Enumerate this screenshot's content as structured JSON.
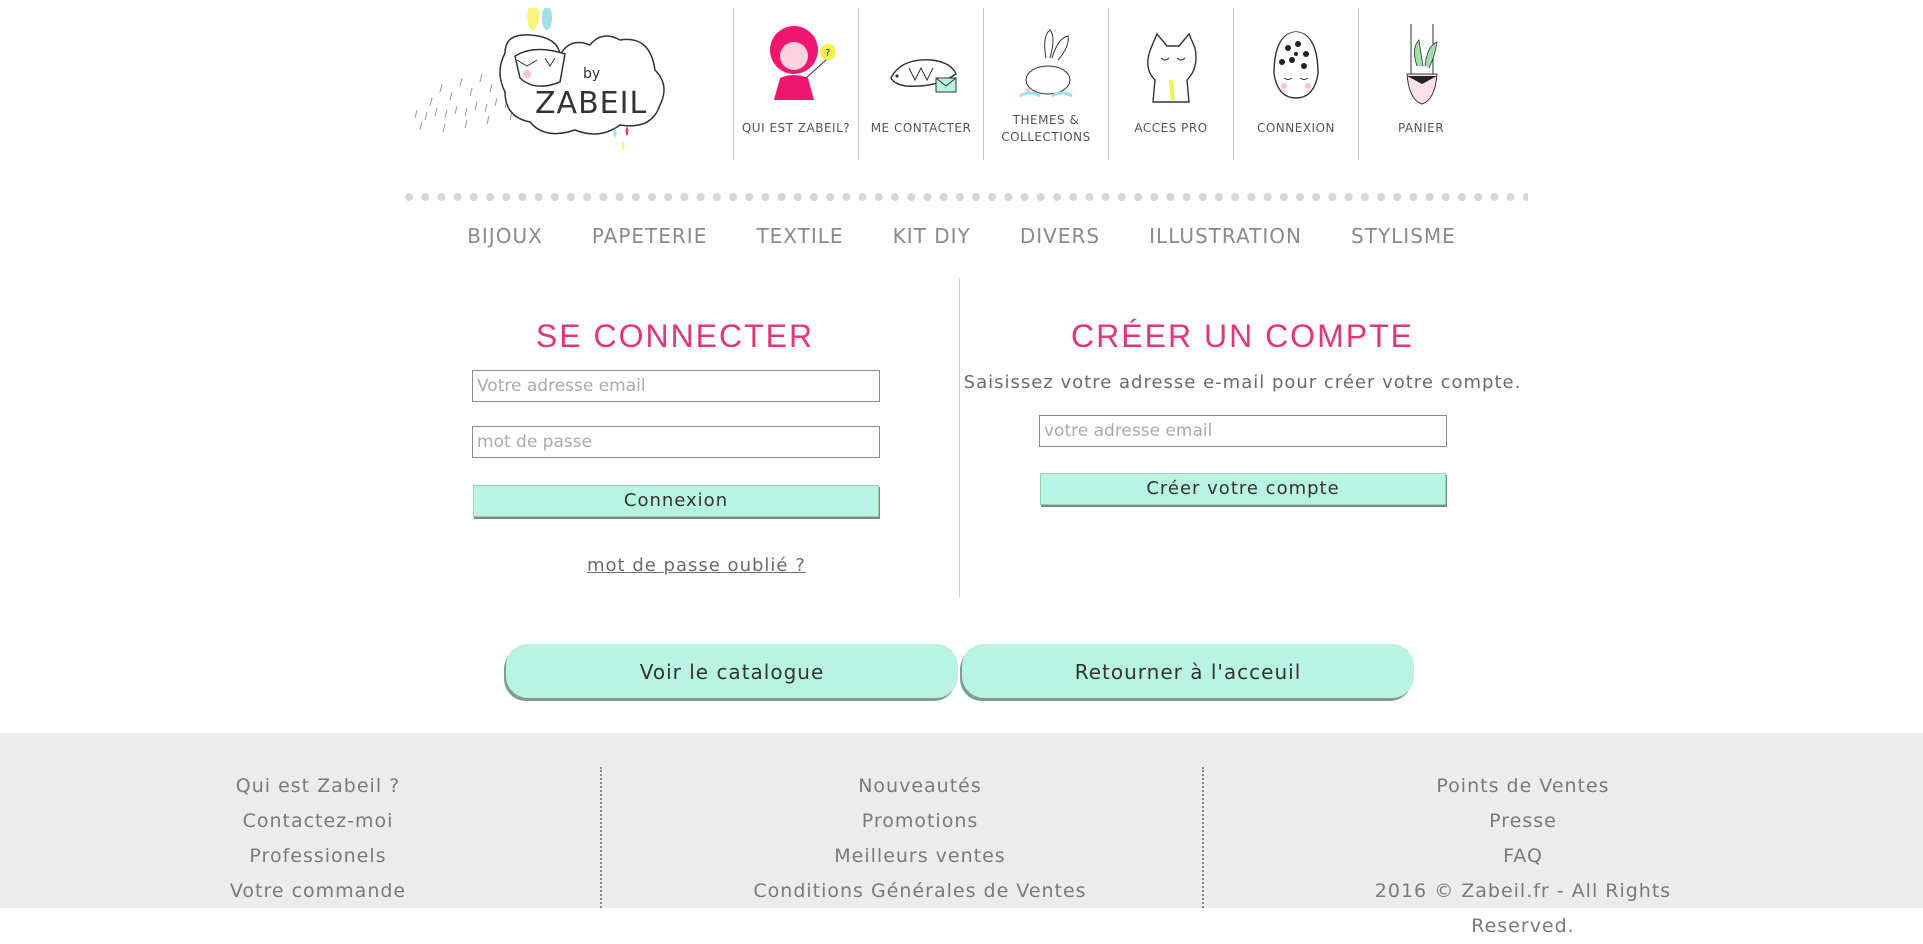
{
  "logo": {
    "by": "by",
    "brand": "ZABEIL"
  },
  "topnav": [
    {
      "label": "QUI EST ZABEIL?",
      "icon": "red-hood-girl-icon"
    },
    {
      "label": "ME CONTACTER",
      "icon": "bird-letter-icon"
    },
    {
      "label": "THEMES &",
      "label2": "COLLECTIONS",
      "icon": "rabbit-icon"
    },
    {
      "label": "ACCES PRO",
      "icon": "cat-icon"
    },
    {
      "label": "CONNEXION",
      "icon": "egg-character-icon"
    },
    {
      "label": "PANIER",
      "icon": "hanging-plant-icon"
    }
  ],
  "catnav": [
    "BIJOUX",
    "PAPETERIE",
    "TEXTILE",
    "KIT DIY",
    "DIVERS",
    "ILLUSTRATION",
    "STYLISME"
  ],
  "login": {
    "title": "SE CONNECTER",
    "email_placeholder": "Votre adresse email",
    "password_placeholder": "mot de passe",
    "submit": "Connexion",
    "forgot": "mot de passe oublié ?"
  },
  "register": {
    "title": "CRÉER UN COMPTE",
    "hint": "Saisissez votre adresse e-mail pour créer votre compte.",
    "email_placeholder": "votre adresse email",
    "submit": "Créer votre compte"
  },
  "actions": {
    "catalogue": "Voir le catalogue",
    "home": "Retourner à l'acceuil"
  },
  "footer": {
    "col1": [
      "Qui est Zabeil ?",
      "Contactez-moi",
      "Professionels",
      "Votre commande"
    ],
    "col2": [
      "Nouveautés",
      "Promotions",
      "Meilleurs ventes",
      "Conditions Générales de Ventes"
    ],
    "col3": [
      "Points de Ventes",
      "Presse",
      "FAQ",
      "2016 © Zabeil.fr - All Rights Reserved."
    ]
  },
  "colors": {
    "accent": "#e2357c",
    "mint": "#b7f5e2",
    "footer_bg": "#ececec"
  }
}
